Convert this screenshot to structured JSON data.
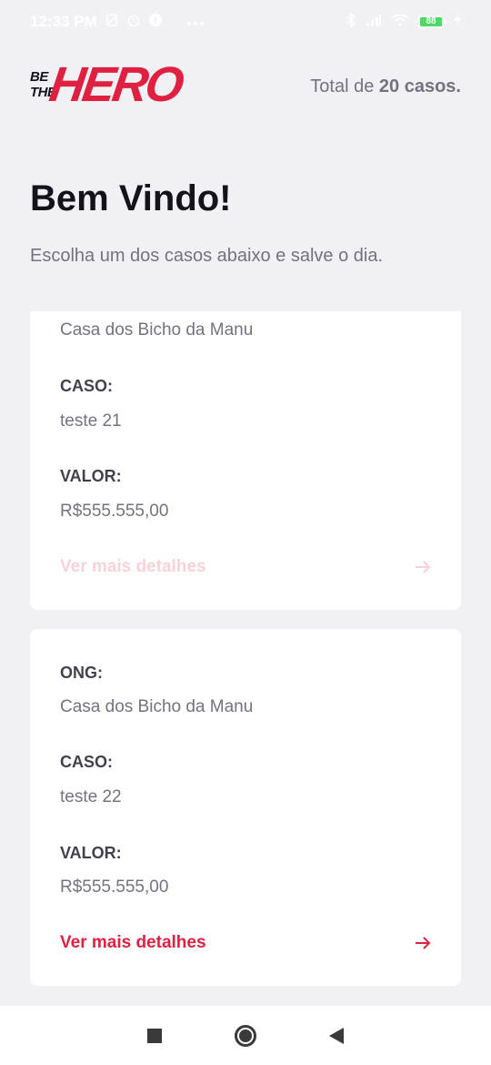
{
  "status_bar": {
    "time": "12:33 PM",
    "battery": "88",
    "left_icons": [
      "no-sim-icon",
      "alarm-icon",
      "facebook-icon",
      "more-dots-icon"
    ],
    "right_icons": [
      "bluetooth-icon",
      "signal-icon",
      "wifi-icon",
      "battery-icon",
      "charging-icon"
    ]
  },
  "header": {
    "logo_be": "BE",
    "logo_the": "THE",
    "logo_hero": "HERO",
    "total_prefix": "Total de",
    "total_value": "20 casos."
  },
  "title": "Bem Vindo!",
  "description": "Escolha um dos casos abaixo e salve o dia.",
  "incidents": [
    {
      "ong_value": "Casa dos Bicho da Manu",
      "caso_label": "CASO:",
      "caso_value": "teste 21",
      "valor_label": "VALOR:",
      "valor_value": "R$555.555,00",
      "details_label": "Ver mais detalhes"
    },
    {
      "ong_label": "ONG:",
      "ong_value": "Casa dos Bicho da Manu",
      "caso_label": "CASO:",
      "caso_value": "teste 22",
      "valor_label": "VALOR:",
      "valor_value": "R$555.555,00",
      "details_label": "Ver mais detalhes"
    }
  ],
  "colors": {
    "accent": "#e02041",
    "background": "#f0f0f5",
    "text_dark": "#13131a",
    "text_muted": "#737380",
    "label": "#41414d"
  }
}
